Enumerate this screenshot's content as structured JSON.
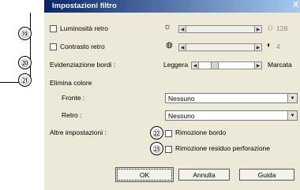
{
  "dialog": {
    "title": "Impostazioni filtro",
    "close_glyph": "X"
  },
  "callouts": [
    "⑲",
    "⑳",
    "㉑",
    "㉒",
    "㉓"
  ],
  "options": {
    "backlight": {
      "label": "Luminosità retro",
      "value": "128",
      "checked": false
    },
    "contrast": {
      "label": "Contrasto retro",
      "value": "4",
      "checked": false
    },
    "edge": {
      "label": "Evidenziazione bordi :",
      "min_label": "Leggera",
      "max_label": "Marcata",
      "level": 0.25
    }
  },
  "color_removal": {
    "heading": "Elimina colore",
    "front_label": "Fronte :",
    "front_value": "Nessuno",
    "back_label": "Retro :",
    "back_value": "Nessuno"
  },
  "other": {
    "heading": "Altre impostazioni :",
    "border_removal": "Rimozione bordo",
    "punch_removal": "Rimozione residuo perforazione"
  },
  "buttons": {
    "ok": "OK",
    "cancel": "Annulla",
    "help": "Guida"
  },
  "icons": [
    "sun-icon",
    "sun-large-icon",
    "contrast-low-icon",
    "contrast-high-icon",
    "scroll-left-icon",
    "scroll-right-icon",
    "dropdown-arrow-icon"
  ]
}
